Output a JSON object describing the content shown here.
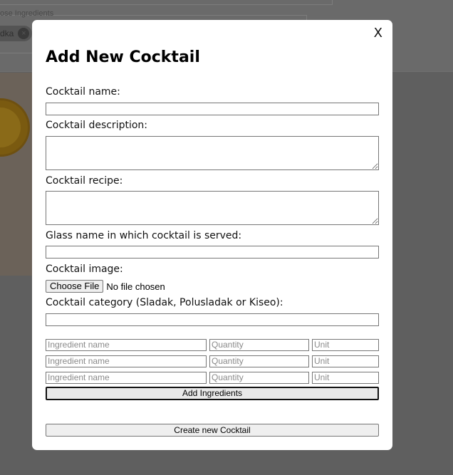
{
  "background": {
    "legend": "ose Ingredients",
    "chip_label": "dka",
    "chip_remove": "×"
  },
  "modal": {
    "close_label": "X",
    "title": "Add New Cocktail",
    "fields": {
      "name_label": "Cocktail name:",
      "name_value": "",
      "description_label": "Cocktail description:",
      "description_value": "",
      "recipe_label": "Cocktail recipe:",
      "recipe_value": "",
      "glass_label": "Glass name in which cocktail is served:",
      "glass_value": "",
      "image_label": "Cocktail image:",
      "file_button": "Choose File",
      "file_status": "No file chosen",
      "category_label": "Cocktail category (Sladak, Polusladak or Kiseo):",
      "category_value": ""
    },
    "ingredients": [
      {
        "name_placeholder": "Ingredient name",
        "qty_placeholder": "Quantity",
        "unit_placeholder": "Unit"
      },
      {
        "name_placeholder": "Ingredient name",
        "qty_placeholder": "Quantity",
        "unit_placeholder": "Unit"
      },
      {
        "name_placeholder": "Ingredient name",
        "qty_placeholder": "Quantity",
        "unit_placeholder": "Unit"
      }
    ],
    "add_ingredients_label": "Add Ingredients",
    "create_label": "Create new Cocktail"
  }
}
